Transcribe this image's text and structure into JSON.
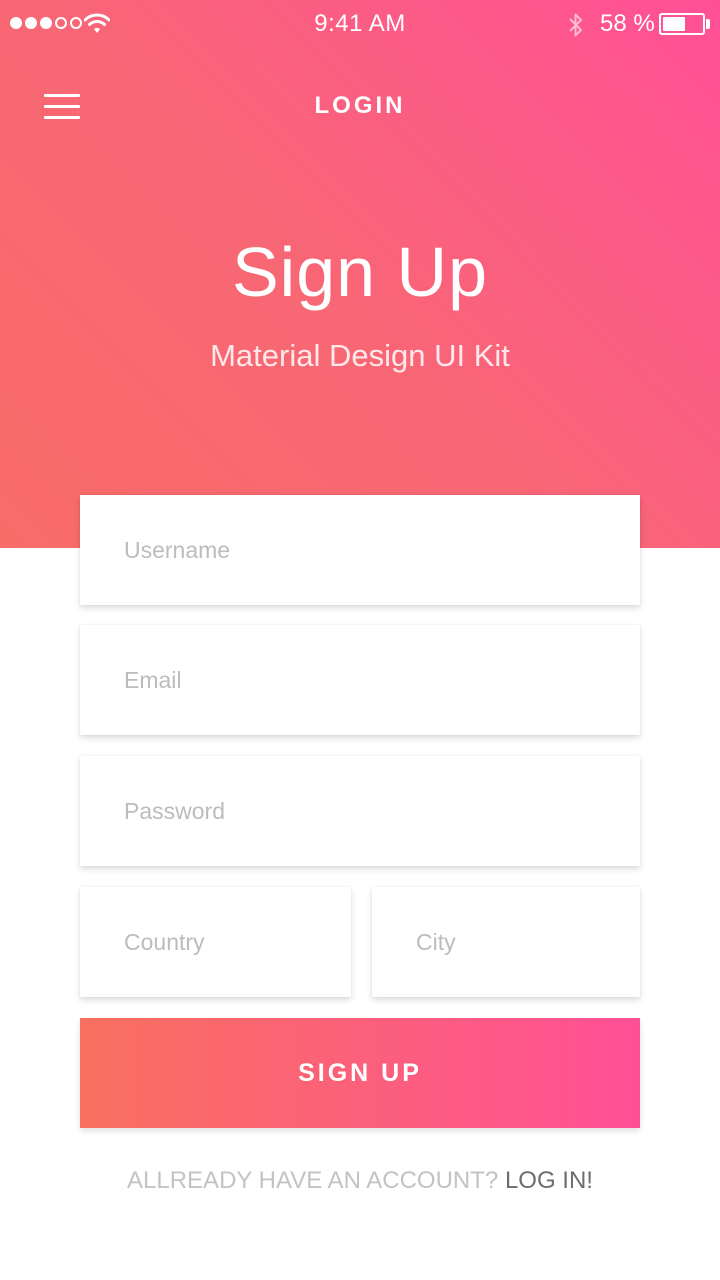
{
  "status_bar": {
    "time": "9:41 AM",
    "battery_percent_text": "58 %",
    "battery_level": 0.58,
    "signal_bars_filled": 3,
    "signal_bars_total": 5,
    "icons": [
      "signal-icon",
      "wifi-icon",
      "bluetooth-icon",
      "battery-icon"
    ]
  },
  "nav": {
    "menu_icon": "hamburger-menu-icon",
    "title": "LOGIN"
  },
  "hero": {
    "title": "Sign Up",
    "subtitle": "Material Design UI Kit"
  },
  "form": {
    "username_placeholder": "Username",
    "email_placeholder": "Email",
    "password_placeholder": "Password",
    "country_placeholder": "Country",
    "city_placeholder": "City",
    "submit_label": "SIGN UP"
  },
  "footer": {
    "question": "ALLREADY HAVE AN ACCOUNT?",
    "link": "LOG IN!"
  },
  "colors": {
    "gradient_start": "#f86c68",
    "gradient_end": "#ff5096",
    "placeholder": "#bcbcbc",
    "footer_question": "#c3c3c3",
    "footer_link": "#6d6d6d"
  }
}
